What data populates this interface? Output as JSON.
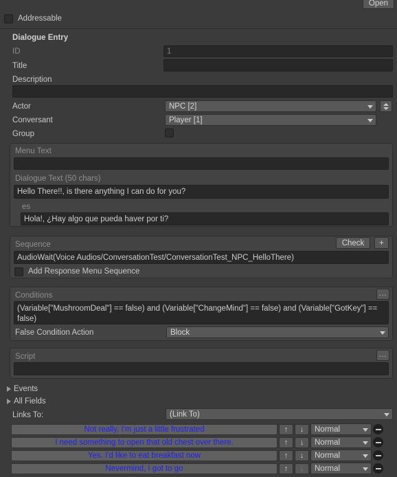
{
  "toolbar": {
    "open_label": "Open"
  },
  "addressable": {
    "label": "Addressable",
    "checked": false
  },
  "section": {
    "title": "Dialogue Entry"
  },
  "fields": {
    "id": {
      "label": "ID",
      "value": "1"
    },
    "title": {
      "label": "Title",
      "value": ""
    },
    "description": {
      "label": "Description",
      "value": ""
    },
    "actor": {
      "label": "Actor",
      "value": "NPC [2]"
    },
    "conversant": {
      "label": "Conversant",
      "value": "Player [1]"
    },
    "group": {
      "label": "Group",
      "checked": false
    }
  },
  "menu_text": {
    "label": "Menu Text",
    "value": ""
  },
  "dialogue_text": {
    "label": "Dialogue Text (50 chars)",
    "value": "Hello There!!, is there anything I can do for you?",
    "locale_label": "es",
    "locale_value": "Hola!, ¿Hay algo que pueda haver por ti?"
  },
  "sequence": {
    "label": "Sequence",
    "check_label": "Check",
    "plus_label": "+",
    "value": "AudioWait(Voice Audios/ConversationTest/ConversationTest_NPC_HelloThere)",
    "add_response_menu_label": "Add Response Menu Sequence",
    "add_response_menu_checked": false
  },
  "conditions": {
    "label": "Conditions",
    "menu_label": "...",
    "value": "(Variable[\"MushroomDeal\"] == false) and (Variable[\"ChangeMind\"] == false) and (Variable[\"GotKey\"] == false)",
    "false_condition_action_label": "False Condition Action",
    "false_condition_action_value": "Block"
  },
  "script": {
    "label": "Script",
    "menu_label": "...",
    "value": ""
  },
  "foldouts": [
    {
      "label": "Events",
      "expanded": false
    },
    {
      "label": "All Fields",
      "expanded": false
    }
  ],
  "links": {
    "label": "Links To:",
    "dropdown_value": "(Link To)",
    "up_icon": "↑",
    "down_icon": "↓",
    "rows": [
      {
        "text": "Not really, I'm just a little frustrated",
        "priority": "Normal",
        "down_disabled": false
      },
      {
        "text": "I need something to open that old chest over there.",
        "priority": "Normal",
        "down_disabled": false
      },
      {
        "text": "Yes. I'd like to eat breakfast now",
        "priority": "Normal",
        "down_disabled": false
      },
      {
        "text": "Nevermind, I got to go",
        "priority": "Normal",
        "down_disabled": true
      }
    ]
  },
  "colors": {
    "background": "#3b3b3b",
    "panel": "#434343",
    "field": "#282828",
    "control": "#585858",
    "link_text": "#2222ee"
  }
}
